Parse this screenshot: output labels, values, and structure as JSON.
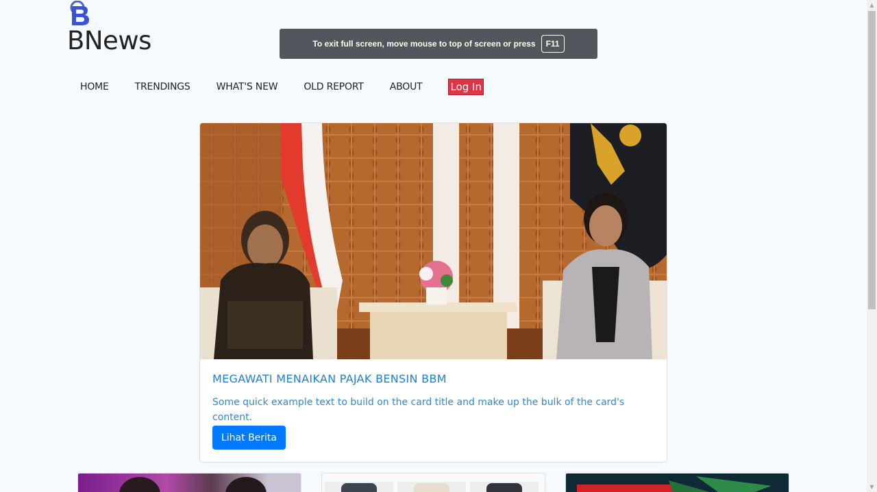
{
  "site": {
    "brand": "BNews",
    "logo_icon": "b-logo-icon",
    "accent": "#007bff",
    "danger": "#dc3545"
  },
  "fullscreen_notice": {
    "text": "To exit full screen, move mouse to top of screen or press",
    "key": "F11"
  },
  "nav": {
    "items": [
      {
        "label": "HOME"
      },
      {
        "label": "TRENDINGS"
      },
      {
        "label": "WHAT'S NEW"
      },
      {
        "label": "OLD REPORT"
      },
      {
        "label": "ABOUT"
      }
    ],
    "login_label": "Log In"
  },
  "featured": {
    "title": "MEGAWATI MENAIKAN PAJAK BENSIN BBM",
    "text": "Some quick example text to build on the card title and make up the bulk of the card's content.",
    "button_label": "Lihat Berita"
  }
}
